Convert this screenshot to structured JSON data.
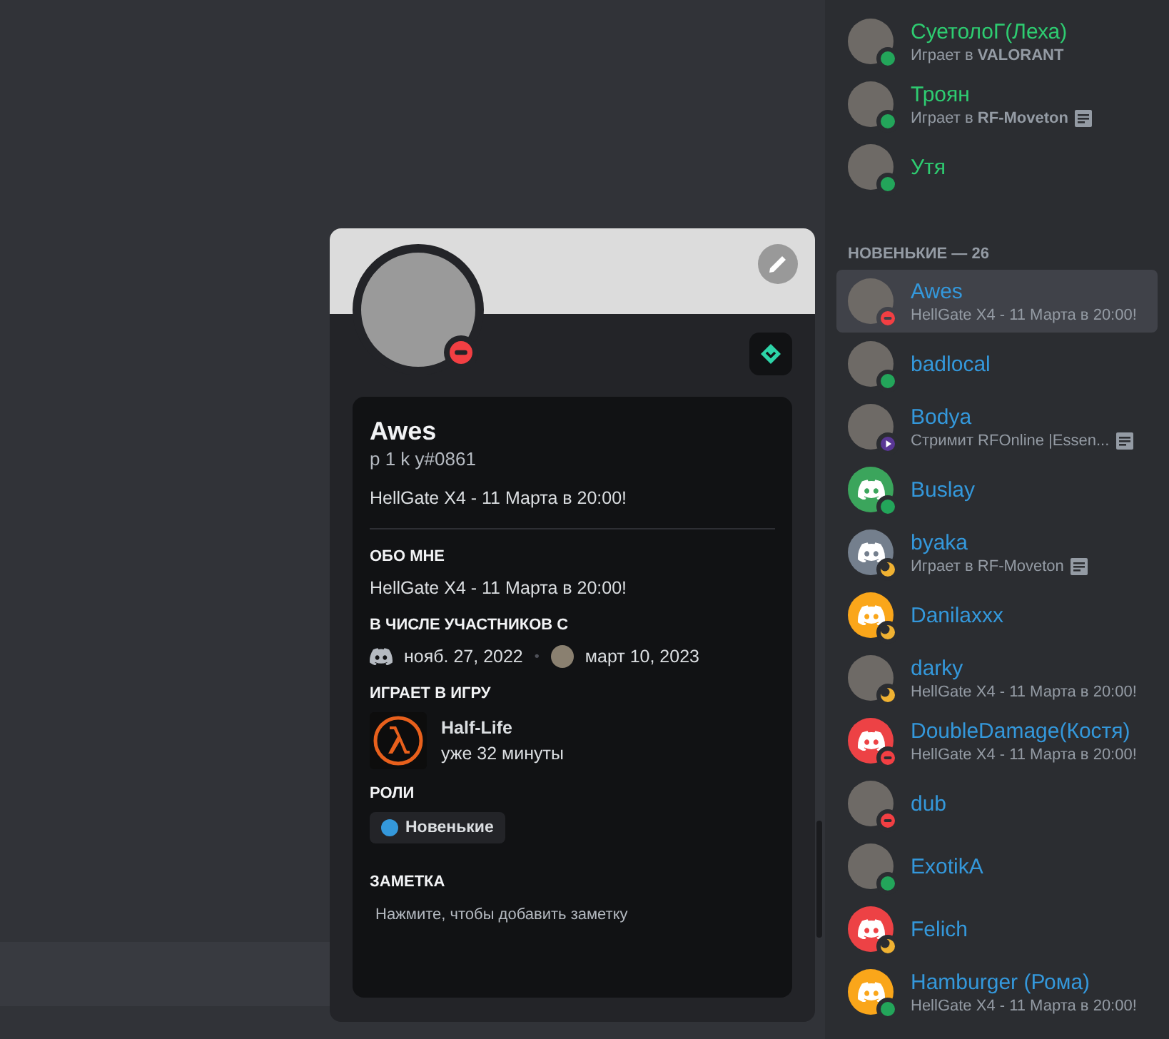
{
  "profile": {
    "status": {
      "kind": "dnd",
      "color": "#f23f43"
    },
    "display_name": "Awes",
    "username": "p 1 k y#0861",
    "custom_status": "HellGate X4 - 11 Марта в 20:00!",
    "sections": [
      {
        "kind": "about",
        "title": "ОБО МНЕ",
        "text": "HellGate X4 - 11 Марта в 20:00!"
      },
      {
        "kind": "member_since",
        "title": "В ЧИСЛЕ УЧАСТНИКОВ С",
        "discord_date": "нояб. 27, 2022",
        "separator": "•",
        "server_date": "март 10, 2023"
      },
      {
        "kind": "game",
        "title": "ИГРАЕТ В ИГРУ",
        "game": "Half-Life",
        "elapsed": "уже 32 минуты"
      },
      {
        "kind": "roles",
        "title": "РОЛИ",
        "roles": [
          {
            "name": "Новенькие",
            "color": "#3498db"
          }
        ]
      },
      {
        "kind": "note",
        "title": "ЗАМЕТКА",
        "placeholder": "Нажмите, чтобы добавить заметку"
      }
    ]
  },
  "members": {
    "groups": [
      {
        "color": "#2ecc71",
        "members": [
          {
            "name": "СуетолоГ(Леха)",
            "activity": "Играет в **VALORANT**",
            "status": {
              "kind": "online",
              "color": "#23a55a"
            },
            "avatar": {
              "kind": "photo"
            },
            "selected": false
          },
          {
            "name": "Троян",
            "activity": "Играет в **RF-Moveton**",
            "details_icon": true,
            "status": {
              "kind": "online",
              "color": "#23a55a"
            },
            "avatar": {
              "kind": "photo"
            },
            "selected": false
          },
          {
            "name": "Утя",
            "status": {
              "kind": "online",
              "color": "#23a55a"
            },
            "avatar": {
              "kind": "photo"
            },
            "selected": false
          }
        ]
      },
      {
        "title": "НОВЕНЬКИЕ — 26",
        "color": "#3498db",
        "members": [
          {
            "name": "Awes",
            "activity": "HellGate X4 - 11 Марта в 20:00!",
            "status": {
              "kind": "dnd",
              "color": "#f23f43"
            },
            "avatar": {
              "kind": "photo"
            },
            "selected": true
          },
          {
            "name": "badlocal",
            "status": {
              "kind": "online",
              "color": "#23a55a"
            },
            "avatar": {
              "kind": "photo"
            },
            "selected": false
          },
          {
            "name": "Bodya",
            "activity": "Стримит RFOnline |Essen...",
            "details_icon": true,
            "status": {
              "kind": "streaming",
              "color": "#593695"
            },
            "avatar": {
              "kind": "photo"
            },
            "selected": false
          },
          {
            "name": "Buslay",
            "status": {
              "kind": "online",
              "color": "#23a55a"
            },
            "avatar": {
              "kind": "default",
              "color": "#3ba55c"
            },
            "selected": false
          },
          {
            "name": "byaka",
            "activity": "Играет в RF-Moveton",
            "details_icon": true,
            "status": {
              "kind": "idle",
              "color": "#f0b232"
            },
            "avatar": {
              "kind": "default",
              "color": "#747f8d"
            },
            "selected": false
          },
          {
            "name": "Danilaxxx",
            "status": {
              "kind": "idle",
              "color": "#f0b232"
            },
            "avatar": {
              "kind": "default",
              "color": "#faa61a"
            },
            "selected": false
          },
          {
            "name": "darky",
            "activity": "HellGate X4 - 11 Марта в 20:00!",
            "status": {
              "kind": "idle",
              "color": "#f0b232"
            },
            "avatar": {
              "kind": "photo"
            },
            "selected": false
          },
          {
            "name": "DoubleDamage(Костя)",
            "activity": "HellGate X4 - 11 Марта в 20:00!",
            "status": {
              "kind": "dnd",
              "color": "#f23f43"
            },
            "avatar": {
              "kind": "default",
              "color": "#ed4245"
            },
            "selected": false
          },
          {
            "name": "dub",
            "status": {
              "kind": "dnd",
              "color": "#f23f43"
            },
            "avatar": {
              "kind": "photo"
            },
            "selected": false
          },
          {
            "name": "ExotikA",
            "status": {
              "kind": "online",
              "color": "#23a55a"
            },
            "avatar": {
              "kind": "photo"
            },
            "selected": false
          },
          {
            "name": "Felich",
            "status": {
              "kind": "idle",
              "color": "#f0b232"
            },
            "avatar": {
              "kind": "default",
              "color": "#ed4245"
            },
            "selected": false
          },
          {
            "name": "Hamburger (Рома)",
            "activity": "HellGate X4 - 11 Марта в 20:00!",
            "status": {
              "kind": "online",
              "color": "#23a55a"
            },
            "avatar": {
              "kind": "default",
              "color": "#faa61a"
            },
            "selected": false
          }
        ]
      }
    ]
  }
}
